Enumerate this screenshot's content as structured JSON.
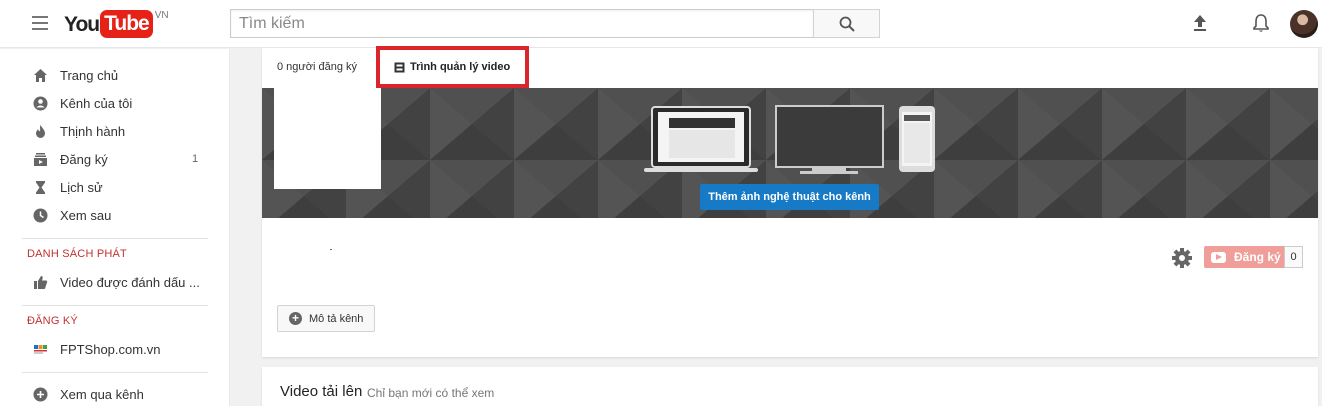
{
  "header": {
    "logo_you": "You",
    "logo_tube": "Tube",
    "logo_region": "VN",
    "search_placeholder": "Tìm kiếm",
    "icons": [
      "menu-icon",
      "search-icon",
      "upload-icon",
      "bell-icon",
      "avatar"
    ]
  },
  "sidebar": {
    "items": [
      {
        "label": "Trang chủ",
        "icon": "home-icon"
      },
      {
        "label": "Kênh của tôi",
        "icon": "account-icon"
      },
      {
        "label": "Thịnh hành",
        "icon": "flame-icon"
      },
      {
        "label": "Đăng ký",
        "icon": "subscriptions-icon",
        "count": "1"
      },
      {
        "label": "Lịch sử",
        "icon": "hourglass-icon"
      },
      {
        "label": "Xem sau",
        "icon": "clock-icon"
      }
    ],
    "playlists_heading": "DANH SÁCH PHÁT",
    "playlists": [
      {
        "label": "Video được đánh dấu ...",
        "icon": "thumbs-up-icon"
      }
    ],
    "subscriptions_heading": "ĐĂNG KÝ",
    "subscriptions": [
      {
        "label": "FPTShop.com.vn",
        "icon": "fpt-logo-icon"
      }
    ],
    "browse": {
      "label": "Xem qua kênh",
      "icon": "add-circle-icon"
    }
  },
  "channel": {
    "subscriber_tab": "0 người đăng ký",
    "video_manager_tab": "Trình quản lý video",
    "add_art_button": "Thêm ảnh nghệ thuật cho kênh",
    "subscribe_button": "Đăng ký",
    "subscribe_count": "0",
    "description_button": "Mô tả kênh",
    "uploads_title": "Video tải lên",
    "uploads_subtitle": "Chỉ bạn mới có thể xem"
  },
  "colors": {
    "brand_red": "#e62117",
    "highlight_border": "#d9252b",
    "primary_blue": "#167ac6",
    "subscribe_disabled": "#f09e9a",
    "banner_bg": "#4b4b4b",
    "section_heading": "#c03131"
  }
}
